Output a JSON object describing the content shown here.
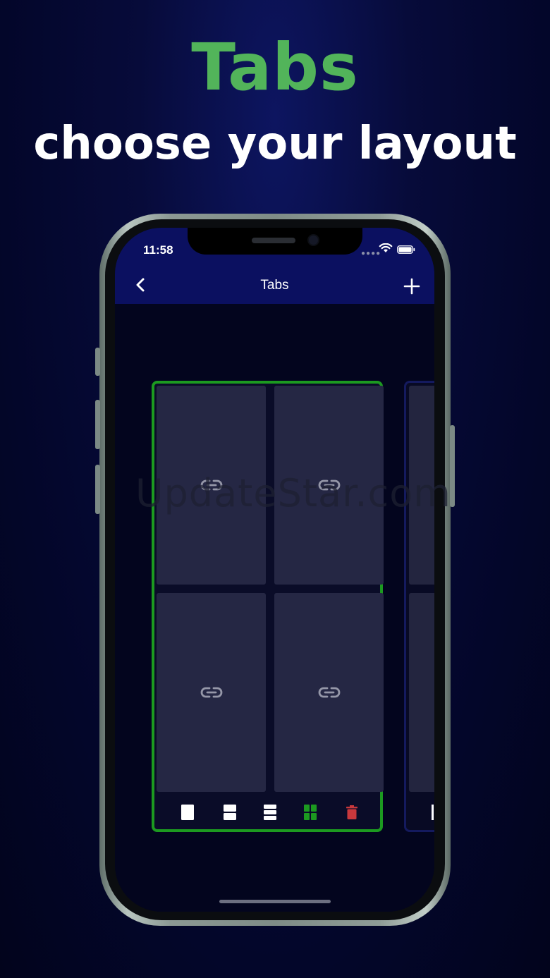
{
  "promo": {
    "headline": "Tabs",
    "subheadline": "choose your layout"
  },
  "status_bar": {
    "time": "11:58"
  },
  "nav": {
    "title": "Tabs"
  },
  "layout_toolbar": {
    "options": [
      "single-pane",
      "two-rows",
      "three-rows",
      "grid-2x2",
      "delete"
    ],
    "selected": "grid-2x2"
  },
  "colors": {
    "headline": "#52b45a",
    "selected_border": "#1c9a20",
    "nav_background": "#0b1060",
    "delete": "#c8383c"
  },
  "watermark": "UpdateStar.com"
}
